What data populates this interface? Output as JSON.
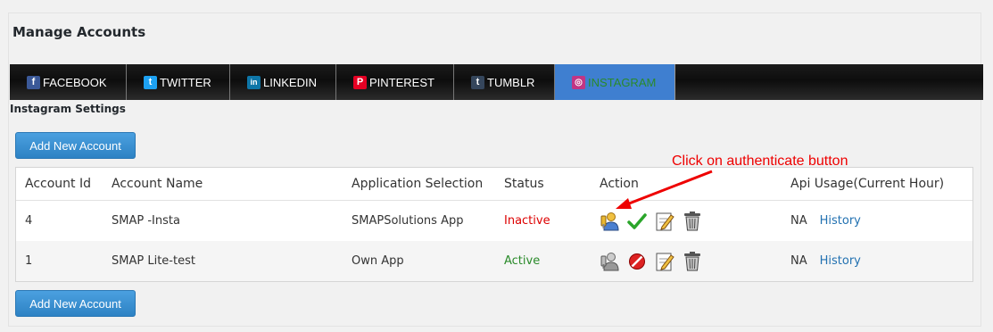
{
  "page": {
    "title": "Manage Accounts"
  },
  "tabs": [
    {
      "label": "FACEBOOK",
      "icon": "facebook-icon",
      "glyph": "f",
      "color": "#3b5998",
      "active": false
    },
    {
      "label": "TWITTER",
      "icon": "twitter-icon",
      "glyph": "t",
      "color": "#1da1f2",
      "active": false
    },
    {
      "label": "LINKEDIN",
      "icon": "linkedin-icon",
      "glyph": "in",
      "color": "#0e76a8",
      "active": false
    },
    {
      "label": "PINTEREST",
      "icon": "pinterest-icon",
      "glyph": "P",
      "color": "#e60023",
      "active": false
    },
    {
      "label": "TUMBLR",
      "icon": "tumblr-icon",
      "glyph": "t",
      "color": "#35465c",
      "active": false
    },
    {
      "label": "INSTAGRAM",
      "icon": "instagram-icon",
      "glyph": "◎",
      "color": "#c13584",
      "active": true
    }
  ],
  "settings": {
    "title": "Instagram Settings",
    "add_button_label": "Add New Account"
  },
  "table": {
    "headers": [
      "Account Id",
      "Account Name",
      "Application Selection",
      "Status",
      "Action",
      "Api Usage(Current Hour)"
    ],
    "rows": [
      {
        "id": "4",
        "name": "SMAP -Insta",
        "app": "SMAPSolutions App",
        "status": "Inactive",
        "usage": "NA",
        "history": "History"
      },
      {
        "id": "1",
        "name": "SMAP Lite-test",
        "app": "Own App",
        "status": "Active",
        "usage": "NA",
        "history": "History"
      }
    ]
  },
  "annotation": {
    "text": "Click on authenticate button",
    "color": "#e00000"
  },
  "colors": {
    "tab_active": "#3f7fd0",
    "button": "#3490d6",
    "inactive": "#dd0000",
    "active": "#2a8a2a"
  }
}
